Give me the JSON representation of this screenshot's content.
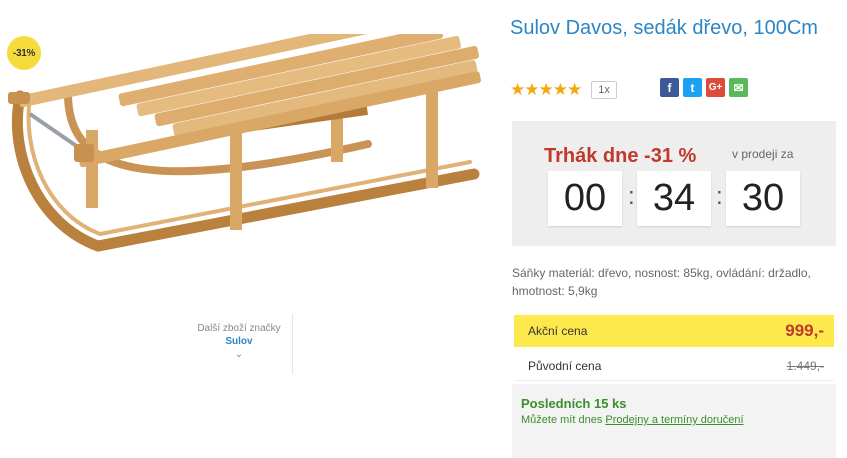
{
  "product": {
    "title": "Sulov Davos, sedák dřevo, 100Cm",
    "discount_badge": "-31%",
    "rating": {
      "stars": 5,
      "count_label": "1x"
    },
    "social_icons": [
      "facebook-icon",
      "twitter-icon",
      "googleplus-icon",
      "email-icon"
    ],
    "social_labels": {
      "facebook": "f",
      "twitter": "t",
      "googleplus": "G+",
      "email": "✉"
    }
  },
  "brand": {
    "label": "Další zboží značky",
    "name": "Sulov",
    "chevron": "⌄"
  },
  "deal": {
    "title": "Trhák dne -31 %",
    "subtitle": "v prodeji za",
    "hours": "00",
    "minutes": "34",
    "seconds": "30",
    "separator": ":"
  },
  "description": "Sáňky materiál: dřevo, nosnost: 85kg, ovládání: držadlo, hmotnost: 5,9kg",
  "pricing": {
    "sale_label": "Akční cena",
    "sale_price": "999,-",
    "original_label": "Původní cena",
    "original_price": "1.449,-"
  },
  "stock": {
    "title": "Posledních 15 ks",
    "text": "Můžete mít dnes",
    "link": "Prodejny a termíny doručení"
  },
  "colors": {
    "title_blue": "#2a86c4",
    "deal_red": "#c0392b",
    "sale_yellow": "#fde94c",
    "stock_green": "#3a8f2b",
    "star_gold": "#f2a90f"
  }
}
